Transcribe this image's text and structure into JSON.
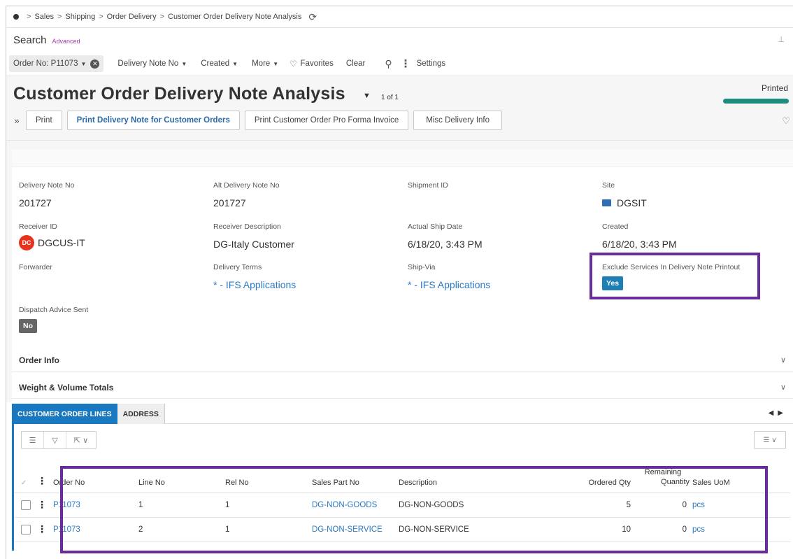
{
  "breadcrumb": [
    "Sales",
    "Shipping",
    "Order Delivery",
    "Customer Order Delivery Note Analysis"
  ],
  "search": {
    "label": "Search",
    "advanced": "Advanced"
  },
  "filters": {
    "chip": "Order No: P11073",
    "items": [
      "Delivery Note No",
      "Created",
      "More"
    ],
    "favorites": "Favorites",
    "clear": "Clear",
    "settings": "Settings"
  },
  "page": {
    "title": "Customer Order Delivery Note Analysis",
    "pager": "1 of 1",
    "status": "Printed",
    "status_color": "#1e8c7e"
  },
  "commands": {
    "print": "Print",
    "print_delivery_note": "Print Delivery Note for Customer Orders",
    "print_pro_forma": "Print Customer Order Pro Forma Invoice",
    "misc_delivery": "Misc Delivery Info"
  },
  "form": {
    "delivery_note_no": {
      "label": "Delivery Note No",
      "value": "201727"
    },
    "alt_delivery_note_no": {
      "label": "Alt Delivery Note No",
      "value": "201727"
    },
    "shipment_id": {
      "label": "Shipment ID",
      "value": ""
    },
    "site": {
      "label": "Site",
      "value": "DGSIT"
    },
    "receiver_id": {
      "label": "Receiver ID",
      "value": "DGCUS-IT",
      "avatar": "DC"
    },
    "receiver_description": {
      "label": "Receiver Description",
      "value": "DG-Italy Customer"
    },
    "actual_ship_date": {
      "label": "Actual Ship Date",
      "value": "6/18/20, 3:43 PM"
    },
    "created": {
      "label": "Created",
      "value": "6/18/20, 3:43 PM"
    },
    "forwarder": {
      "label": "Forwarder",
      "value": ""
    },
    "delivery_terms": {
      "label": "Delivery Terms",
      "value": "* - IFS Applications"
    },
    "ship_via": {
      "label": "Ship-Via",
      "value": "* - IFS Applications"
    },
    "exclude_services": {
      "label": "Exclude Services In Delivery Note Printout",
      "value": "Yes"
    },
    "dispatch_advice_sent": {
      "label": "Dispatch Advice Sent",
      "value": "No"
    }
  },
  "sections": {
    "order_info": "Order Info",
    "weight_volume": "Weight & Volume Totals"
  },
  "tabs": [
    "CUSTOMER ORDER LINES",
    "ADDRESS"
  ],
  "grid": {
    "headers": {
      "order_no": "Order No",
      "line_no": "Line No",
      "rel_no": "Rel No",
      "sales_part_no": "Sales Part No",
      "description": "Description",
      "ordered_qty": "Ordered Qty",
      "remaining_1": "Remaining",
      "remaining_2": "Quantity",
      "sales_uom": "Sales UoM"
    },
    "rows": [
      {
        "order_no": "P11073",
        "line_no": "1",
        "rel_no": "1",
        "sales_part_no": "DG-NON-GOODS",
        "description": "DG-NON-GOODS",
        "ordered_qty": "5",
        "remaining_qty": "0",
        "sales_uom": "pcs"
      },
      {
        "order_no": "P11073",
        "line_no": "2",
        "rel_no": "1",
        "sales_part_no": "DG-NON-SERVICE",
        "description": "DG-NON-SERVICE",
        "ordered_qty": "10",
        "remaining_qty": "0",
        "sales_uom": "pcs"
      }
    ]
  },
  "colors": {
    "accent": "#1878c0",
    "highlight": "#6a2c9b",
    "link": "#2b79c2"
  }
}
